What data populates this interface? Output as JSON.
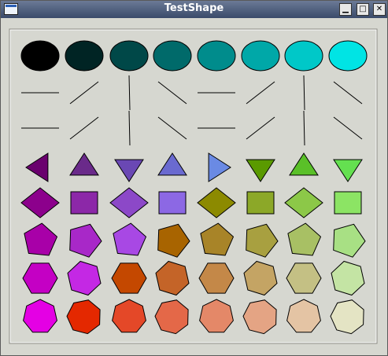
{
  "window": {
    "title": "TestShape",
    "controls": {
      "minimize": "▁",
      "maximize": "□",
      "close": "✕"
    }
  },
  "colors": {
    "titlebar_start": "#6b7a96",
    "titlebar_end": "#3a4a6a",
    "background": "#d6d7d0",
    "frame_dark": "#8a8a82",
    "frame_light": "#ffffff",
    "outline": "#000000"
  },
  "shapes": {
    "ellipses": [
      "#000000",
      "#002424",
      "#004848",
      "#006a6a",
      "#008c8c",
      "#00a8a8",
      "#00c8c8",
      "#00e4e4"
    ],
    "lines_top": [
      "h",
      "d1",
      "v",
      "d2",
      "h",
      "d1",
      "v",
      "d2"
    ],
    "lines_bottom": [
      "h",
      "d1",
      "v",
      "d2",
      "h",
      "d1",
      "v",
      "d2"
    ],
    "triangles": [
      {
        "dir": "left",
        "color": "#6a006e"
      },
      {
        "dir": "up",
        "color": "#6a2a8a"
      },
      {
        "dir": "down",
        "color": "#6a48b4"
      },
      {
        "dir": "up",
        "color": "#6a6ad0"
      },
      {
        "dir": "right",
        "color": "#6a8ae4"
      },
      {
        "dir": "down",
        "color": "#5a9a00"
      },
      {
        "dir": "up",
        "color": "#5ac028"
      },
      {
        "dir": "down",
        "color": "#64e050"
      }
    ],
    "diamonds": [
      {
        "kind": "diamond",
        "color": "#8c008c"
      },
      {
        "kind": "square",
        "color": "#8c28a8"
      },
      {
        "kind": "diamond",
        "color": "#8c48c8"
      },
      {
        "kind": "square",
        "color": "#8c68e4"
      },
      {
        "kind": "diamond",
        "color": "#8c8a00"
      },
      {
        "kind": "square",
        "color": "#8ca828"
      },
      {
        "kind": "diamond",
        "color": "#8cc848"
      },
      {
        "kind": "square",
        "color": "#8ce464"
      }
    ],
    "pentagons": [
      "#a800a8",
      "#a828c8",
      "#a848e4",
      "#a86400",
      "#a88428",
      "#a8a040",
      "#a8c064",
      "#a8e084"
    ],
    "hexagons": [
      "#c400c4",
      "#c428e4",
      "#c44800",
      "#c46428",
      "#c48848",
      "#c4a464",
      "#c4c084",
      "#c4e4a4"
    ],
    "heptagons": [
      "#e400e4",
      "#e42800",
      "#e44828",
      "#e46848",
      "#e48868",
      "#e4a484",
      "#e4c4a4",
      "#e4e4c4"
    ]
  }
}
